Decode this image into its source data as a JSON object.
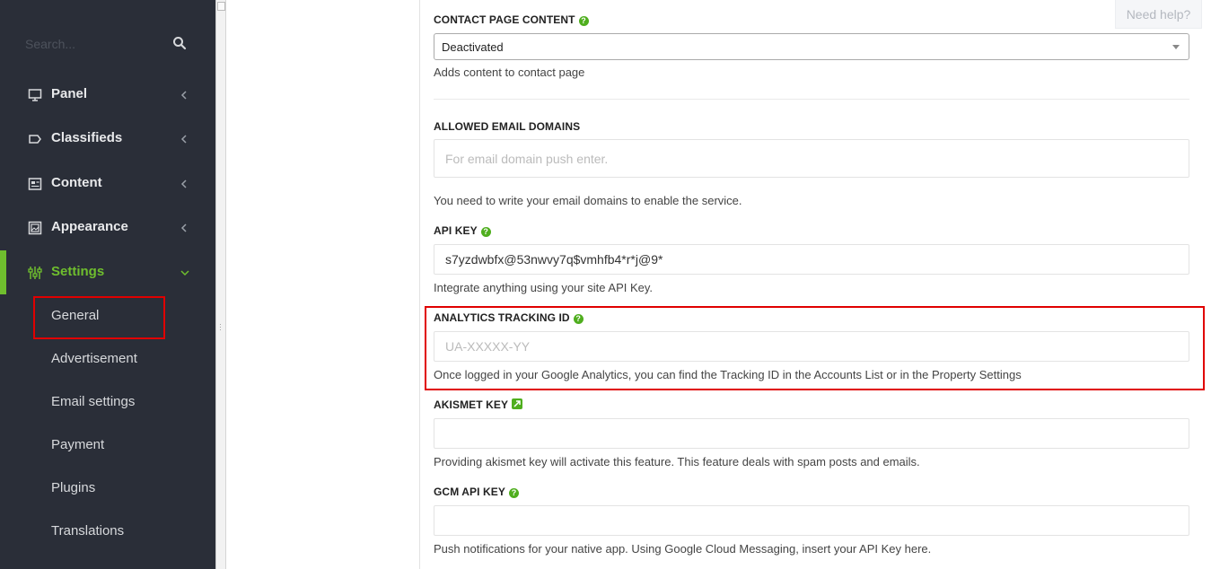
{
  "sidebar": {
    "search_placeholder": "Search...",
    "items": [
      {
        "label": "Panel",
        "icon": "monitor-icon"
      },
      {
        "label": "Classifieds",
        "icon": "tag-icon"
      },
      {
        "label": "Content",
        "icon": "newspaper-icon"
      },
      {
        "label": "Appearance",
        "icon": "image-icon"
      },
      {
        "label": "Settings",
        "icon": "sliders-icon"
      }
    ],
    "sub_items": [
      "General",
      "Advertisement",
      "Email settings",
      "Payment",
      "Plugins",
      "Translations"
    ]
  },
  "need_help": "Need help?",
  "fields": {
    "contact": {
      "label": "CONTACT PAGE CONTENT",
      "value": "Deactivated",
      "help": "Adds content to contact page"
    },
    "email_domains": {
      "label": "ALLOWED EMAIL DOMAINS",
      "placeholder": "For email domain push enter.",
      "help": "You need to write your email domains to enable the service."
    },
    "api_key": {
      "label": "API KEY",
      "value": "s7yzdwbfx@53nwvy7q$vmhfb4*r*j@9*",
      "help": "Integrate anything using your site API Key."
    },
    "analytics": {
      "label": "ANALYTICS TRACKING ID",
      "placeholder": "UA-XXXXX-YY",
      "help": "Once logged in your Google Analytics, you can find the Tracking ID in the Accounts List or in the Property Settings"
    },
    "akismet": {
      "label": "AKISMET KEY",
      "value": "",
      "help": "Providing akismet key will activate this feature. This feature deals with spam posts and emails."
    },
    "gcm": {
      "label": "GCM API KEY",
      "value": "",
      "help": "Push notifications for your native app. Using Google Cloud Messaging, insert your API Key here."
    }
  },
  "colors": {
    "sidebar_bg": "#2a2e38",
    "accent_green": "#6fbe2e",
    "highlight_red": "#e00000"
  }
}
